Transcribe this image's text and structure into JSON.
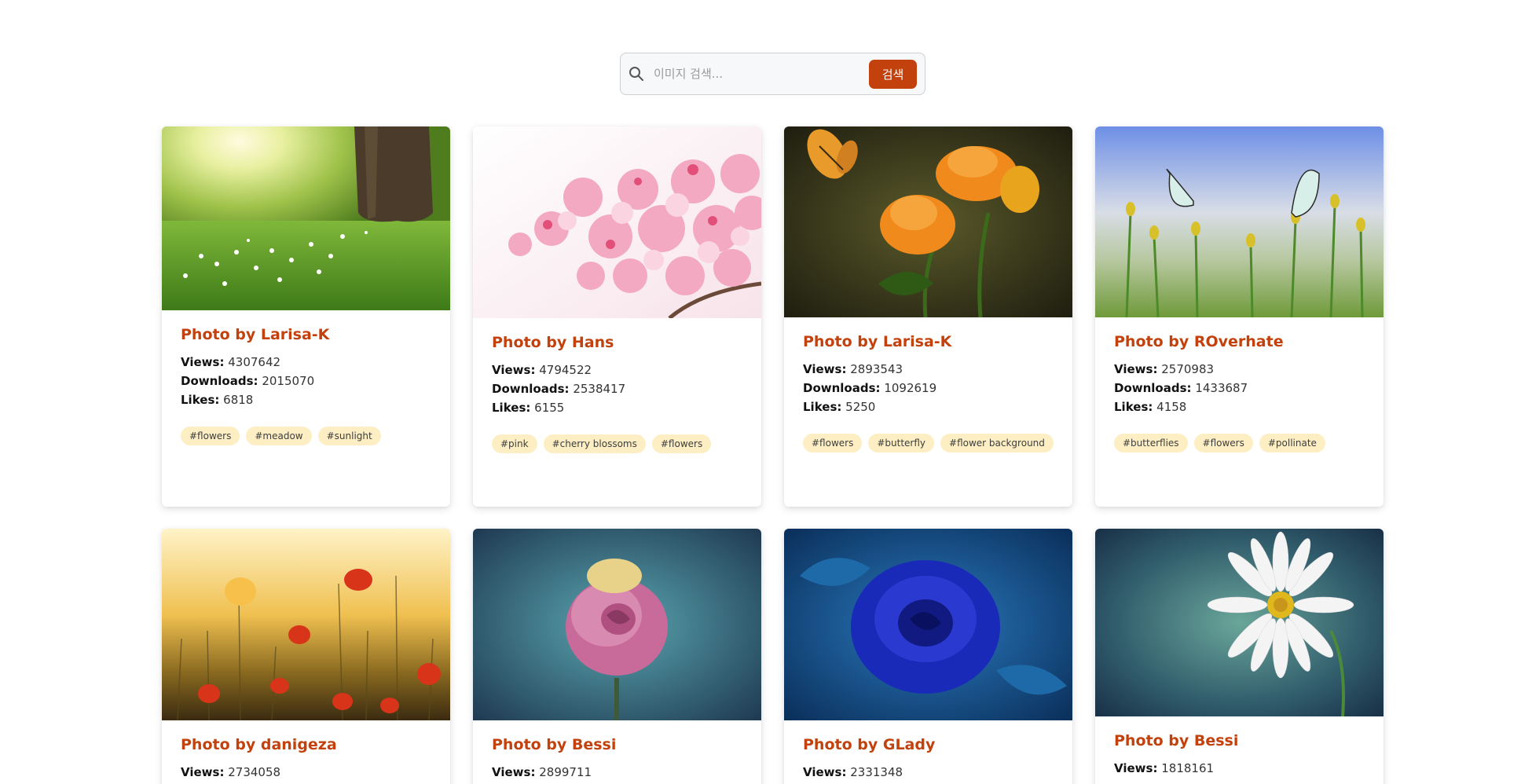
{
  "search": {
    "placeholder": "이미지 검색...",
    "value": "",
    "button_label": "검색"
  },
  "colors": {
    "accent": "#c2410c",
    "tag_bg": "#fdefc3"
  },
  "labels": {
    "views": "Views:",
    "downloads": "Downloads:",
    "likes": "Likes:"
  },
  "photos": [
    {
      "title": "Photo by Larisa-K",
      "views": "4307642",
      "downloads": "2015070",
      "likes": "6818",
      "tags": [
        "#flowers",
        "#meadow",
        "#sunlight"
      ],
      "image": "meadow-sunlight-tree"
    },
    {
      "title": "Photo by Hans",
      "views": "4794522",
      "downloads": "2538417",
      "likes": "6155",
      "tags": [
        "#pink",
        "#cherry blossoms",
        "#flowers"
      ],
      "image": "pink-cherry-blossoms"
    },
    {
      "title": "Photo by Larisa-K",
      "views": "2893543",
      "downloads": "1092619",
      "likes": "5250",
      "tags": [
        "#flowers",
        "#butterfly",
        "#flower background"
      ],
      "image": "orange-flowers-butterfly"
    },
    {
      "title": "Photo by ROverhate",
      "views": "2570983",
      "downloads": "1433687",
      "likes": "4158",
      "tags": [
        "#butterflies",
        "#flowers",
        "#pollinate"
      ],
      "image": "butterflies-field"
    },
    {
      "title": "Photo by danigeza",
      "views": "2734058",
      "downloads": "",
      "likes": "",
      "tags": [],
      "image": "poppies-sunset"
    },
    {
      "title": "Photo by Bessi",
      "views": "2899711",
      "downloads": "",
      "likes": "",
      "tags": [],
      "image": "pink-rose-dew"
    },
    {
      "title": "Photo by GLady",
      "views": "2331348",
      "downloads": "",
      "likes": "",
      "tags": [],
      "image": "blue-rose"
    },
    {
      "title": "Photo by Bessi",
      "views": "1818161",
      "downloads": "",
      "likes": "",
      "tags": [],
      "image": "white-daisy"
    }
  ]
}
